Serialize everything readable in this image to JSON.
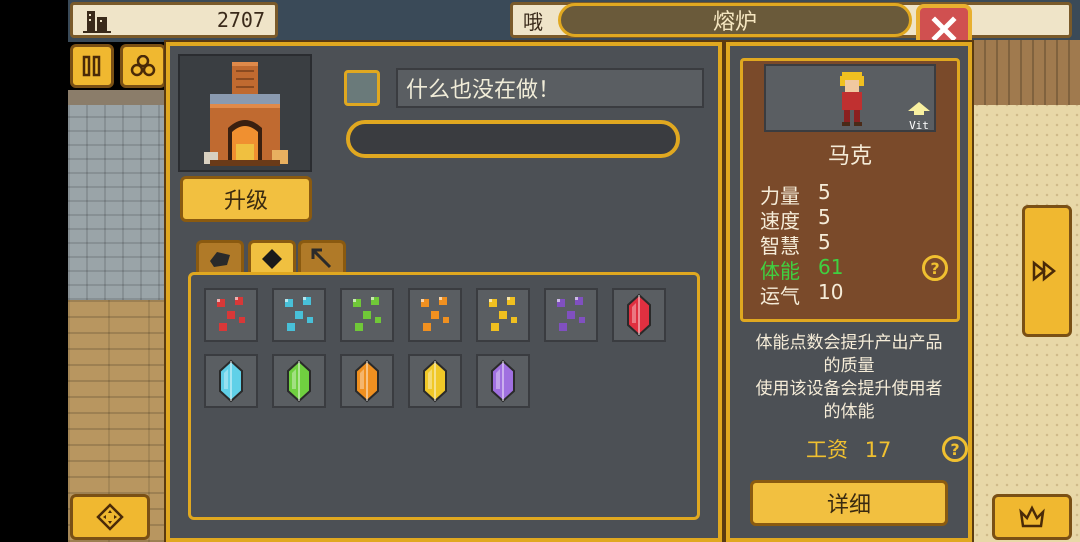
{
  "top": {
    "money": "2707",
    "money_icon": "building-coins-icon",
    "right_bar_text": "哦",
    "title": "熔炉",
    "close_icon": "close-icon"
  },
  "left_buttons": {
    "pause_icon": "pause-icon",
    "items_icon": "coins-icon",
    "dpad_icon": "dpad-icon"
  },
  "furnace": {
    "upgrade_label": "升级",
    "status_text": "什么也没在做！",
    "progress": 0
  },
  "tabs": [
    {
      "icon": "ore-chunk-icon",
      "active": false
    },
    {
      "icon": "gem-icon",
      "active": true
    },
    {
      "icon": "pickaxe-icon",
      "active": false
    }
  ],
  "items": [
    {
      "type": "ore",
      "color": "#d83838"
    },
    {
      "type": "ore",
      "color": "#48c0d8"
    },
    {
      "type": "ore",
      "color": "#70c838"
    },
    {
      "type": "ore",
      "color": "#f09020"
    },
    {
      "type": "ore",
      "color": "#f0c020"
    },
    {
      "type": "ore",
      "color": "#8050c0"
    },
    {
      "type": "crystal",
      "color": "#e03040"
    },
    {
      "type": "crystal",
      "color": "#60d0e8"
    },
    {
      "type": "crystal",
      "color": "#70d040"
    },
    {
      "type": "crystal",
      "color": "#f09020"
    },
    {
      "type": "crystal",
      "color": "#f0c828"
    },
    {
      "type": "crystal",
      "color": "#a070e0"
    }
  ],
  "worker": {
    "name": "马克",
    "badge": "Vit",
    "stats": [
      {
        "label": "力量",
        "value": "5",
        "highlight": false
      },
      {
        "label": "速度",
        "value": "5",
        "highlight": false
      },
      {
        "label": "智慧",
        "value": "5",
        "highlight": false
      },
      {
        "label": "体能",
        "value": "61",
        "highlight": true
      },
      {
        "label": "运气",
        "value": "10",
        "highlight": false
      }
    ],
    "desc_lines": [
      "体能点数会提升产出产品",
      "的质量",
      "使用该设备会提升使用者",
      "的体能"
    ],
    "wage_label": "工资",
    "wage_value": "17",
    "detail_label": "详细"
  },
  "right_buttons": {
    "arrow_icon": "fast-forward-icon",
    "crown_icon": "crown-icon"
  },
  "colors": {
    "accent": "#e0a820",
    "panel": "#4c5055",
    "highlight": "#40d040"
  }
}
